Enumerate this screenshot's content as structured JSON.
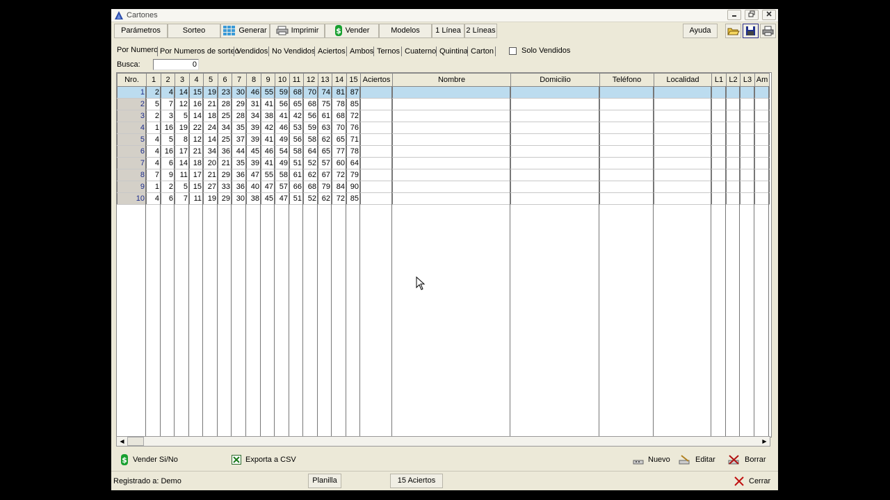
{
  "window": {
    "title": "Cartones"
  },
  "toolbar": {
    "parametros": "Parámetros",
    "sorteo": "Sorteo",
    "generar": "Generar",
    "imprimir": "Imprimir",
    "vender": "Vender",
    "modelos": "Modelos",
    "una_linea": "1 Línea",
    "dos_lineas": "2 Líneas",
    "ayuda": "Ayuda"
  },
  "tabs": [
    "Por Numero",
    "Por Numeros de sorteo",
    "Vendidos",
    "No Vendidos",
    "Aciertos",
    "Ambos",
    "Ternos",
    "Cuaterno",
    "Quintina",
    "Carton"
  ],
  "solo_vendidos": {
    "label": "Solo Vendidos",
    "checked": false
  },
  "busca": {
    "label": "Busca:",
    "value": "0"
  },
  "grid": {
    "headers": [
      "Nro.",
      "1",
      "2",
      "3",
      "4",
      "5",
      "6",
      "7",
      "8",
      "9",
      "10",
      "11",
      "12",
      "13",
      "14",
      "15",
      "Aciertos",
      "Nombre",
      "Domicilio",
      "Teléfono",
      "Localidad",
      "L1",
      "L2",
      "L3",
      "Am"
    ],
    "rows": [
      [
        "1",
        "2",
        "4",
        "14",
        "15",
        "19",
        "23",
        "30",
        "46",
        "55",
        "59",
        "68",
        "70",
        "74",
        "81",
        "87"
      ],
      [
        "2",
        "5",
        "7",
        "12",
        "16",
        "21",
        "28",
        "29",
        "31",
        "41",
        "56",
        "65",
        "68",
        "75",
        "78",
        "85"
      ],
      [
        "3",
        "2",
        "3",
        "5",
        "14",
        "18",
        "25",
        "28",
        "34",
        "38",
        "41",
        "42",
        "56",
        "61",
        "68",
        "72"
      ],
      [
        "4",
        "1",
        "16",
        "19",
        "22",
        "24",
        "34",
        "35",
        "39",
        "42",
        "46",
        "53",
        "59",
        "63",
        "70",
        "76"
      ],
      [
        "5",
        "4",
        "5",
        "8",
        "12",
        "14",
        "25",
        "37",
        "39",
        "41",
        "49",
        "56",
        "58",
        "62",
        "65",
        "71"
      ],
      [
        "6",
        "4",
        "16",
        "17",
        "21",
        "34",
        "36",
        "44",
        "45",
        "46",
        "54",
        "58",
        "64",
        "65",
        "77",
        "78"
      ],
      [
        "7",
        "4",
        "6",
        "14",
        "18",
        "20",
        "21",
        "35",
        "39",
        "41",
        "49",
        "51",
        "52",
        "57",
        "60",
        "64"
      ],
      [
        "8",
        "7",
        "9",
        "11",
        "17",
        "21",
        "29",
        "36",
        "47",
        "55",
        "58",
        "61",
        "62",
        "67",
        "72",
        "79"
      ],
      [
        "9",
        "1",
        "2",
        "5",
        "15",
        "27",
        "33",
        "36",
        "40",
        "47",
        "57",
        "66",
        "68",
        "79",
        "84",
        "90"
      ],
      [
        "10",
        "4",
        "6",
        "7",
        "11",
        "19",
        "29",
        "30",
        "38",
        "45",
        "47",
        "51",
        "52",
        "62",
        "72",
        "85"
      ]
    ],
    "selected_row": 0
  },
  "actions": {
    "vender_si_no": "Vender Si/No",
    "exporta_csv": "Exporta a CSV",
    "nuevo": "Nuevo",
    "editar": "Editar",
    "borrar": "Borrar"
  },
  "status": {
    "registrado": "Registrado a:  Demo",
    "planilla": "Planilla",
    "aciertos": "15 Aciertos",
    "cerrar": "Cerrar"
  },
  "colors": {
    "selection": "#bcdcef",
    "window_bg": "#ece9d8",
    "row_number": "#1a2a8a"
  }
}
